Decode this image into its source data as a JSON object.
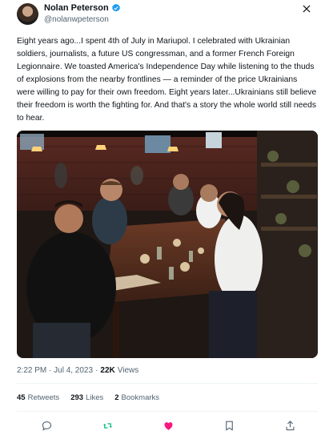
{
  "author": {
    "name": "Nolan Peterson",
    "handle": "@nolanwpeterson",
    "verified": true
  },
  "tweet": {
    "text": "Eight years ago...I spent 4th of July in Mariupol. I celebrated with Ukrainian soldiers, journalists, a future US congressman, and a former French Foreign Legionnaire. We toasted America's Independence Day while listening to the thuds of explosions from the nearby frontlines — a reminder of the price Ukrainians were willing to pay for their own freedom. Eight years later...Ukrainians still believe their freedom is worth the fighting for. And that's a story the whole world still needs to hear.",
    "timestamp": "2:22 PM · Jul 4, 2023",
    "separator": "·",
    "views_count": "22K",
    "views_label": "Views"
  },
  "stats": {
    "retweets_count": "45",
    "retweets_label": "Retweets",
    "likes_count": "293",
    "likes_label": "Likes",
    "bookmarks_count": "2",
    "bookmarks_label": "Bookmarks"
  },
  "icons": {
    "close": "close-icon",
    "verified": "verified-badge-icon",
    "reply": "reply-icon",
    "retweet": "retweet-icon",
    "like": "heart-icon",
    "bookmark": "bookmark-icon",
    "share": "share-icon"
  },
  "colors": {
    "verified": "#1d9bf0",
    "retweeted": "#00ba7c",
    "liked": "#f91880",
    "secondary_text": "#536471"
  }
}
